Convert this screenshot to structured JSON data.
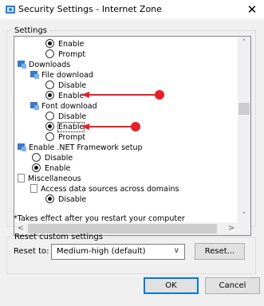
{
  "window": {
    "title": "Security Settings - Internet Zone",
    "close_glyph": "✕"
  },
  "settings": {
    "legend": "Settings",
    "items": [
      {
        "kind": "radio",
        "label": "Enable",
        "selected": true
      },
      {
        "kind": "radio",
        "label": "Prompt",
        "selected": false
      },
      {
        "kind": "category",
        "label": "Downloads"
      },
      {
        "kind": "subcategory",
        "label": "File download"
      },
      {
        "kind": "radio",
        "label": "Disable",
        "selected": false
      },
      {
        "kind": "radio",
        "label": "Enable",
        "selected": true
      },
      {
        "kind": "subcategory",
        "label": "Font download"
      },
      {
        "kind": "radio",
        "label": "Disable",
        "selected": false
      },
      {
        "kind": "radio",
        "label": "Enable",
        "selected": true
      },
      {
        "kind": "radio",
        "label": "Prompt",
        "selected": false
      },
      {
        "kind": "category",
        "label": "Enable .NET Framework setup"
      },
      {
        "kind": "radio",
        "label": "Disable",
        "selected": false
      },
      {
        "kind": "radio",
        "label": "Enable",
        "selected": true
      },
      {
        "kind": "doc",
        "label": "Miscellaneous"
      },
      {
        "kind": "doc",
        "label": "Access data sources across domains"
      },
      {
        "kind": "radio",
        "label": "Disable",
        "selected": true
      }
    ],
    "note": "*Takes effect after you restart your computer"
  },
  "reset": {
    "legend": "Reset custom settings",
    "label": "Reset to:",
    "selected_level": "Medium-high (default)",
    "reset_button": "Reset..."
  },
  "buttons": {
    "ok": "OK",
    "cancel": "Cancel"
  },
  "colors": {
    "annotation_arrow": "#e8202a",
    "title_icon": "#2a7fd4",
    "setting_icon": "#3a78c8"
  },
  "icons": {
    "scroll_up": "chevron-up-icon",
    "scroll_down": "chevron-down-icon",
    "scroll_left": "chevron-left-icon",
    "scroll_right": "chevron-right-icon"
  }
}
